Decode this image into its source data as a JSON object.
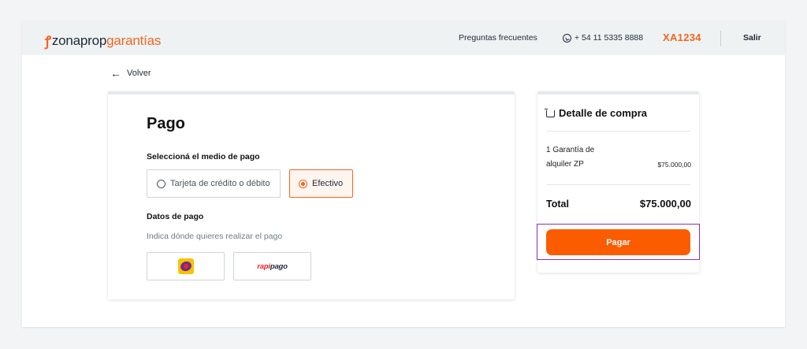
{
  "header": {
    "logo_pin": "ꝭ",
    "logo_main": "zonaprop",
    "logo_accent": "garantías",
    "faq_label": "Preguntas frecuentes",
    "phone": "+ 54 11 5335 8888",
    "user_code": "XA1234",
    "logout_label": "Salir"
  },
  "nav": {
    "back_arrow": "←",
    "back_label": "Volver"
  },
  "payment": {
    "title": "Pago",
    "method_section_label": "Seleccioná el medio de pago",
    "options": [
      {
        "label": "Tarjeta de crédito o débito",
        "selected": false
      },
      {
        "label": "Efectivo",
        "selected": true
      }
    ],
    "data_section_label": "Datos de pago",
    "hint": "Indica dónde quieres realizar el pago",
    "methods": [
      {
        "name": "pagofacil-logo",
        "label": ""
      },
      {
        "name": "rapipago-logo",
        "label_a": "rapi",
        "label_b": "pago"
      }
    ]
  },
  "summary": {
    "title": "Detalle de compra",
    "item_name": "1 Garantía de alquiler ZP",
    "item_price": "$75.000,00",
    "total_label": "Total",
    "total_value": "$75.000,00",
    "pay_button_label": "Pagar"
  },
  "colors": {
    "accent": "#f26522",
    "button": "#fc5c00",
    "highlight_outline": "#8e2fb5"
  },
  "icons": [
    "whatsapp-icon",
    "back-arrow-icon",
    "cart-icon",
    "radio-icon"
  ]
}
